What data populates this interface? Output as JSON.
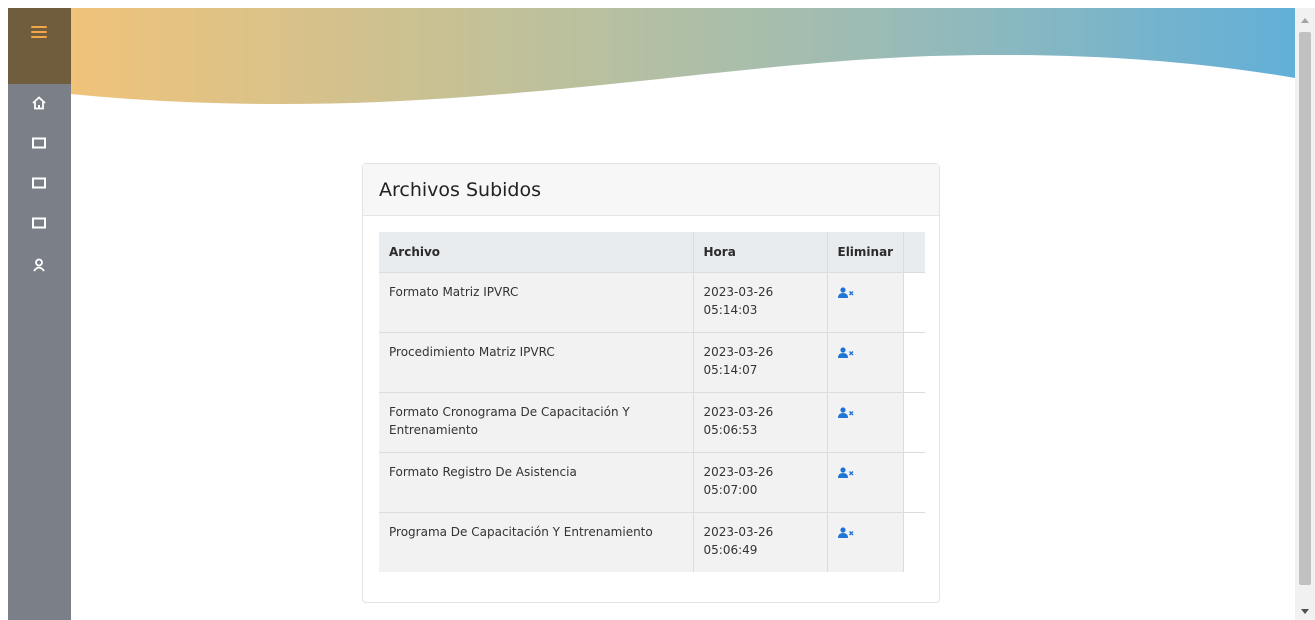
{
  "card": {
    "title": "Archivos Subidos"
  },
  "table": {
    "headers": [
      "Archivo",
      "Hora",
      "Eliminar"
    ],
    "rows": [
      {
        "archivo": "Formato Matriz IPVRC",
        "fecha": "2023-03-26",
        "hora": "05:14:03"
      },
      {
        "archivo": "Procedimiento Matriz IPVRC",
        "fecha": "2023-03-26",
        "hora": "05:14:07"
      },
      {
        "archivo": "Formato Cronograma De Capacitación Y Entrenamiento",
        "fecha": "2023-03-26",
        "hora": "05:06:53"
      },
      {
        "archivo": "Formato Registro De Asistencia",
        "fecha": "2023-03-26",
        "hora": "05:07:00"
      },
      {
        "archivo": "Programa De Capacitación Y Entrenamiento",
        "fecha": "2023-03-26",
        "hora": "05:06:49"
      }
    ]
  },
  "sidebar": {
    "icons": [
      "home-icon",
      "folder-icon",
      "folder-icon",
      "folder-icon",
      "user-icon"
    ]
  },
  "colors": {
    "accent_orange": "#f2a646",
    "sidebar": "#7b8088",
    "delete_icon": "#1f75d6"
  }
}
